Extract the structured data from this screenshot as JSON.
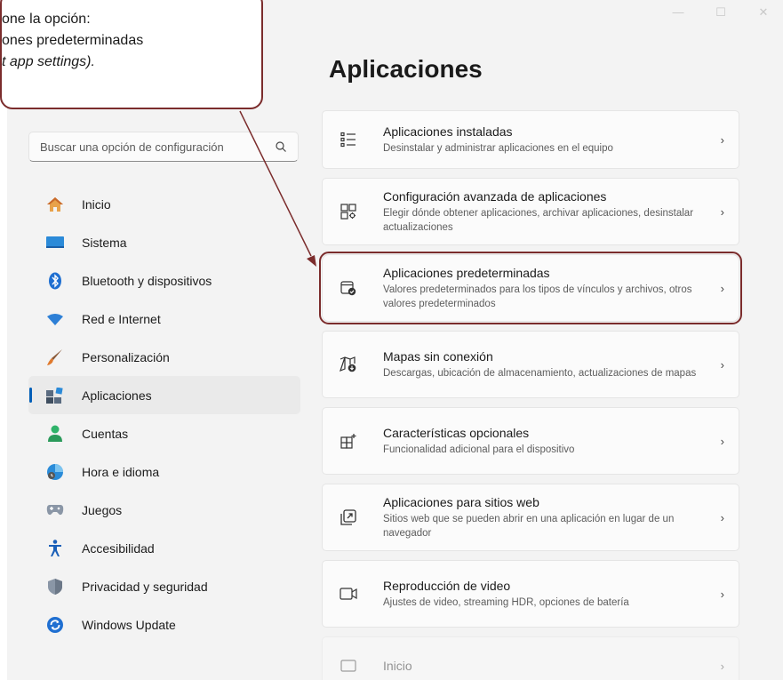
{
  "callout": {
    "line1": "one la opción:",
    "line2": "ones  predeterminadas",
    "line3": "t app settings)."
  },
  "window_controls": {
    "minimize": "—",
    "maximize": "☐",
    "close": "✕"
  },
  "page_title": "Aplicaciones",
  "search": {
    "placeholder": "Buscar una opción de configuración"
  },
  "nav": [
    {
      "label": "Inicio",
      "icon": "home-icon"
    },
    {
      "label": "Sistema",
      "icon": "system-icon"
    },
    {
      "label": "Bluetooth y dispositivos",
      "icon": "bluetooth-icon"
    },
    {
      "label": "Red e Internet",
      "icon": "wifi-icon"
    },
    {
      "label": "Personalización",
      "icon": "brush-icon"
    },
    {
      "label": "Aplicaciones",
      "icon": "apps-icon",
      "active": true
    },
    {
      "label": "Cuentas",
      "icon": "account-icon"
    },
    {
      "label": "Hora e idioma",
      "icon": "time-language-icon"
    },
    {
      "label": "Juegos",
      "icon": "gamepad-icon"
    },
    {
      "label": "Accesibilidad",
      "icon": "accessibility-icon"
    },
    {
      "label": "Privacidad y seguridad",
      "icon": "shield-icon"
    },
    {
      "label": "Windows Update",
      "icon": "update-icon"
    }
  ],
  "cards": [
    {
      "title": "Aplicaciones instaladas",
      "desc": "Desinstalar y administrar aplicaciones en el equipo",
      "icon": "installed-apps-icon"
    },
    {
      "title": "Configuración avanzada de aplicaciones",
      "desc": "Elegir dónde obtener aplicaciones, archivar aplicaciones, desinstalar actualizaciones",
      "icon": "advanced-apps-icon"
    },
    {
      "title": "Aplicaciones predeterminadas",
      "desc": "Valores predeterminados para los tipos de vínculos y archivos, otros valores predeterminados",
      "icon": "default-apps-icon"
    },
    {
      "title": "Mapas sin conexión",
      "desc": "Descargas, ubicación de almacenamiento, actualizaciones de mapas",
      "icon": "offline-maps-icon"
    },
    {
      "title": "Características opcionales",
      "desc": "Funcionalidad adicional para el dispositivo",
      "icon": "optional-features-icon"
    },
    {
      "title": "Aplicaciones para sitios web",
      "desc": "Sitios web que se pueden abrir en una aplicación en lugar de un navegador",
      "icon": "web-apps-icon"
    },
    {
      "title": "Reproducción de video",
      "desc": "Ajustes de video, streaming HDR, opciones de batería",
      "icon": "video-playback-icon"
    },
    {
      "title": "Inicio",
      "desc": "",
      "icon": "startup-icon"
    }
  ],
  "colors": {
    "accent": "#005fb8",
    "callout_border": "#7b2c2c"
  }
}
